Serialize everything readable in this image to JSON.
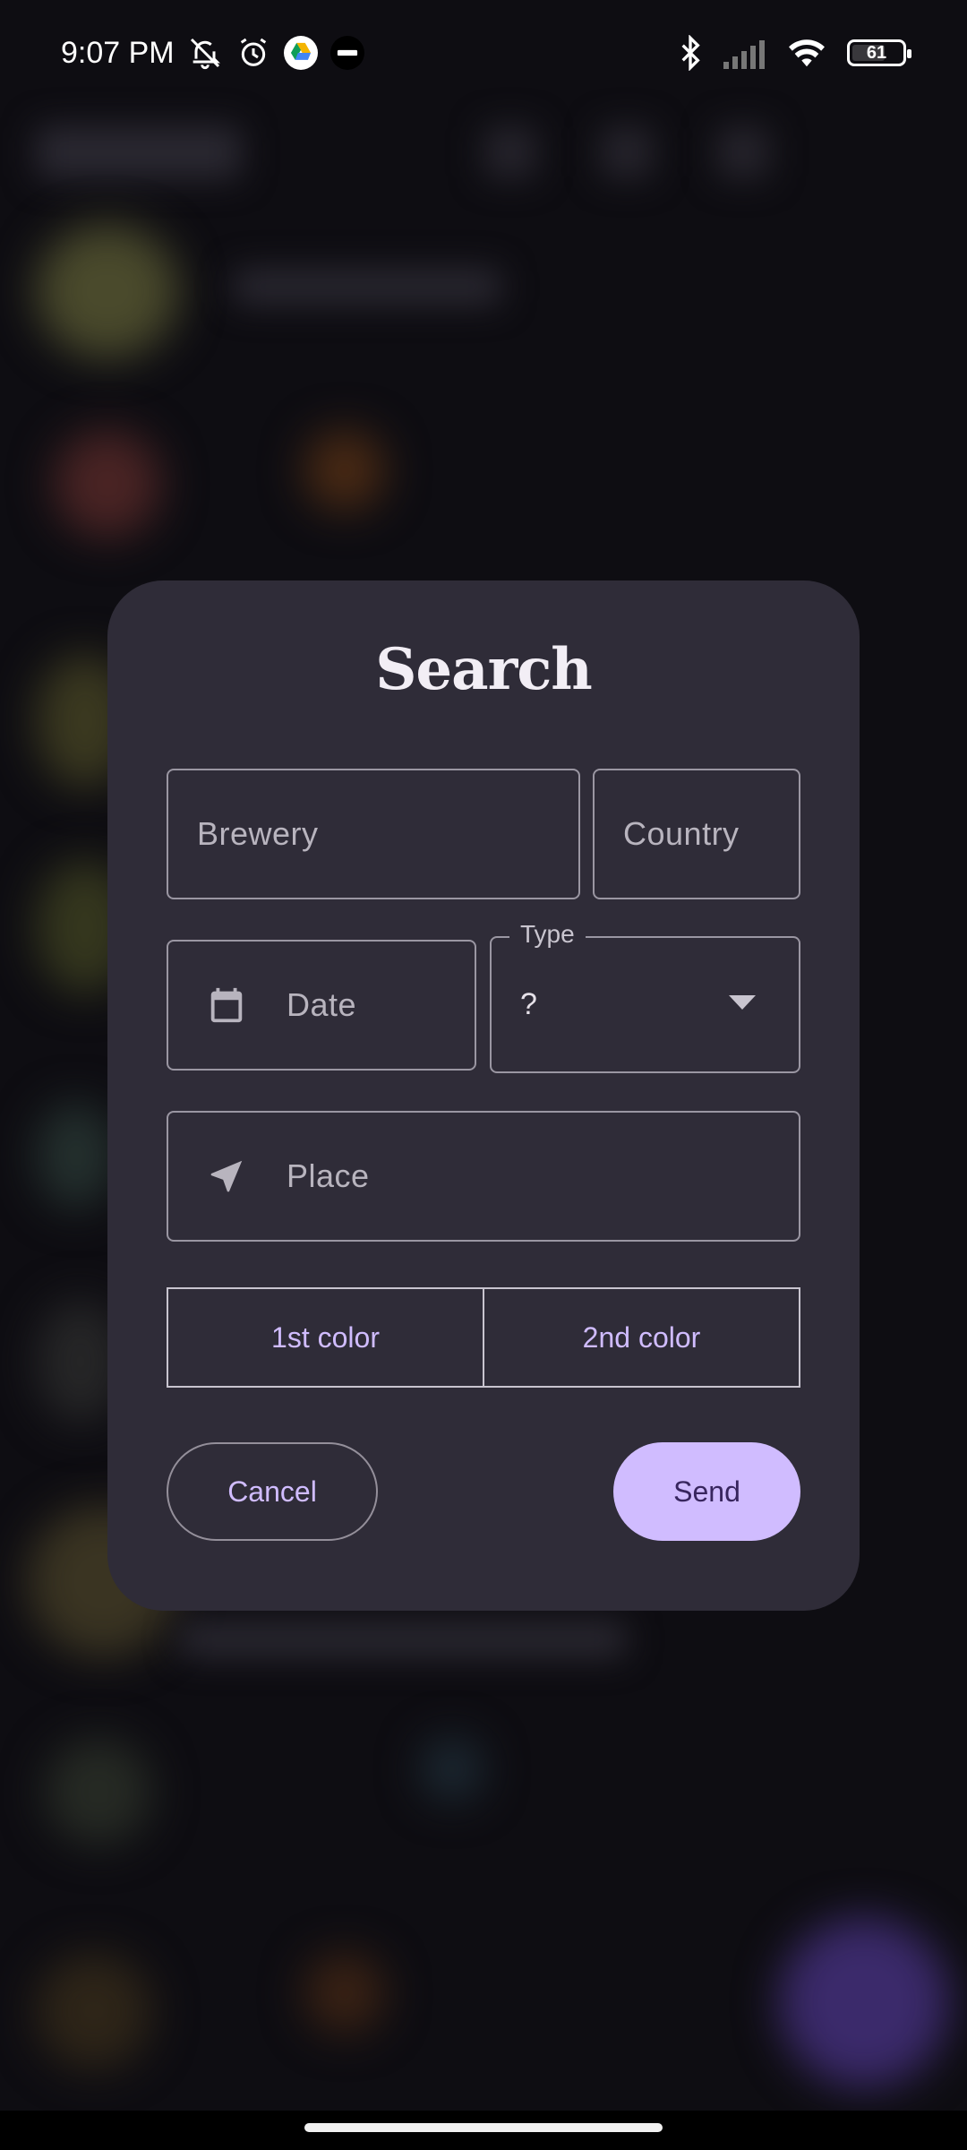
{
  "status_bar": {
    "time": "9:07 PM",
    "battery": "61",
    "icons_left": [
      "bell-off-icon",
      "alarm-icon",
      "drive-icon",
      "bereal-icon"
    ],
    "icons_right": [
      "bluetooth-icon",
      "signal-icon",
      "wifi-icon",
      "battery-icon"
    ]
  },
  "dialog": {
    "title": "Search",
    "brewery_placeholder": "Brewery",
    "country_placeholder": "Country",
    "date_placeholder": "Date",
    "type_label": "Type",
    "type_value": "?",
    "place_placeholder": "Place",
    "color_buttons": [
      "1st color",
      "2nd color"
    ],
    "cancel_label": "Cancel",
    "send_label": "Send"
  },
  "colors": {
    "accent": "#d0bcff",
    "dialog_bg": "#2f2c38",
    "send_text": "#38265e"
  }
}
